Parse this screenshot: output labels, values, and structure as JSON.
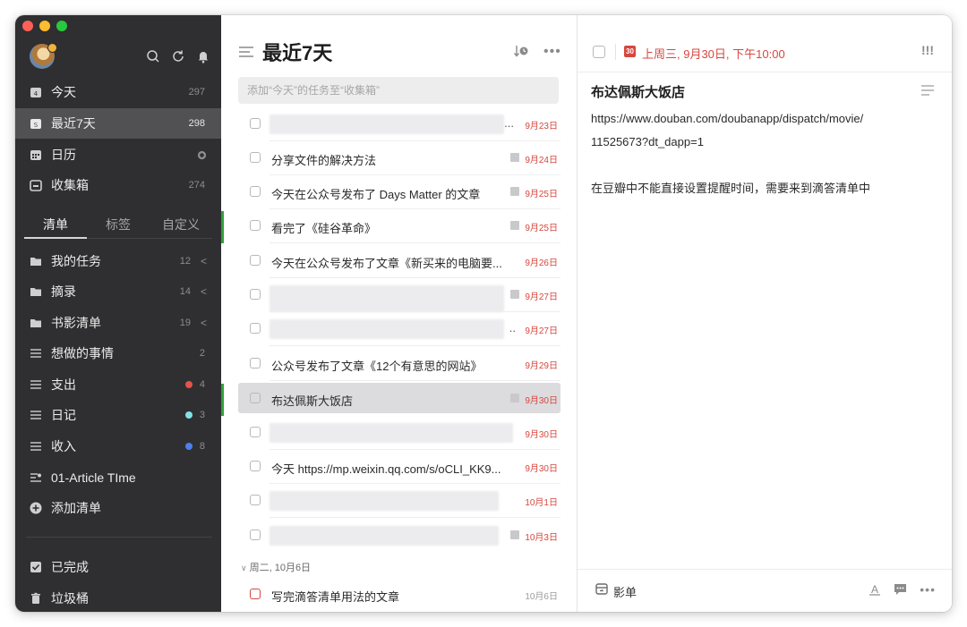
{
  "sidebar": {
    "smart_lists": [
      {
        "label": "今天",
        "count": "297",
        "icon": "today-icon"
      },
      {
        "label": "最近7天",
        "count": "298",
        "icon": "next7days-icon"
      },
      {
        "label": "日历",
        "count": "",
        "icon": "calendar-icon"
      },
      {
        "label": "收集箱",
        "count": "274",
        "icon": "inbox-icon"
      }
    ],
    "tabs": [
      "清单",
      "标签",
      "自定义"
    ],
    "lists": [
      {
        "label": "我的任务",
        "count": "12",
        "icon": "folder-icon",
        "chevron": "<"
      },
      {
        "label": "摘录",
        "count": "14",
        "icon": "folder-icon",
        "chevron": "<"
      },
      {
        "label": "书影清单",
        "count": "19",
        "icon": "folder-icon",
        "chevron": "<"
      },
      {
        "label": "想做的事情",
        "count": "2",
        "icon": "list-icon"
      },
      {
        "label": "支出",
        "count": "4",
        "icon": "list-icon",
        "color": "#e5534b"
      },
      {
        "label": "日记",
        "count": "3",
        "icon": "list-icon",
        "color": "#7fe3e6"
      },
      {
        "label": "收入",
        "count": "8",
        "icon": "list-icon",
        "color": "#4c7ef0"
      },
      {
        "label": "01-Article TIme",
        "count": "",
        "icon": "shared-list-icon"
      },
      {
        "label": "添加清单",
        "count": "",
        "icon": "add-list-icon"
      }
    ],
    "bottom": [
      {
        "label": "已完成",
        "icon": "completed-icon"
      },
      {
        "label": "垃圾桶",
        "icon": "trash-icon"
      }
    ]
  },
  "middle": {
    "title": "最近7天",
    "add_placeholder": "添加“今天”的任务至“收集箱”",
    "tasks": [
      {
        "title": "",
        "blurred": true,
        "ellipsis": "...",
        "date": "9月23日"
      },
      {
        "title": "分享文件的解决方法",
        "date": "9月24日",
        "note": true
      },
      {
        "title": "今天在公众号发布了 Days Matter 的文章",
        "date": "9月25日",
        "note": true
      },
      {
        "title": "看完了《硅谷革命》",
        "date": "9月25日",
        "note": true
      },
      {
        "title": "今天在公众号发布了文章《新买来的电脑要...",
        "date": "9月26日"
      },
      {
        "title": "",
        "blurred": true,
        "date": "9月27日",
        "note": true
      },
      {
        "title": "",
        "blurred": true,
        "ellipsis": "..",
        "date": "9月27日"
      },
      {
        "title": "公众号发布了文章《12个有意思的网站》",
        "date": "9月29日"
      },
      {
        "title": "布达佩斯大饭店",
        "date": "9月30日",
        "note": true,
        "selected": true
      },
      {
        "title": "",
        "blurred": true,
        "date": "9月30日"
      },
      {
        "title": "今天 https://mp.weixin.qq.com/s/oCLI_KK9...",
        "date": "9月30日"
      },
      {
        "title": "",
        "blurred": true,
        "date": "10月1日"
      },
      {
        "title": "",
        "blurred": true,
        "date": "10月3日",
        "note": true
      }
    ],
    "group_header": "周二, 10月6日",
    "group_tasks": [
      {
        "title": "写完滴答清单用法的文章",
        "date": "10月6日"
      }
    ]
  },
  "detail": {
    "calendar_day": "30",
    "due": "上周三, 9月30日, 下午10:00",
    "priority": "!!!",
    "title": "布达佩斯大饭店",
    "content_lines": [
      "https://www.douban.com/doubanapp/dispatch/movie/",
      "11525673?dt_dapp=1",
      "",
      "在豆瓣中不能直接设置提醒时间，需要来到滴答清单中"
    ],
    "list_name": "影单"
  },
  "colors": {
    "accent_red": "#d6473f",
    "sidebar_bg": "#2f2f31",
    "selected_green": "#2fa33b"
  }
}
